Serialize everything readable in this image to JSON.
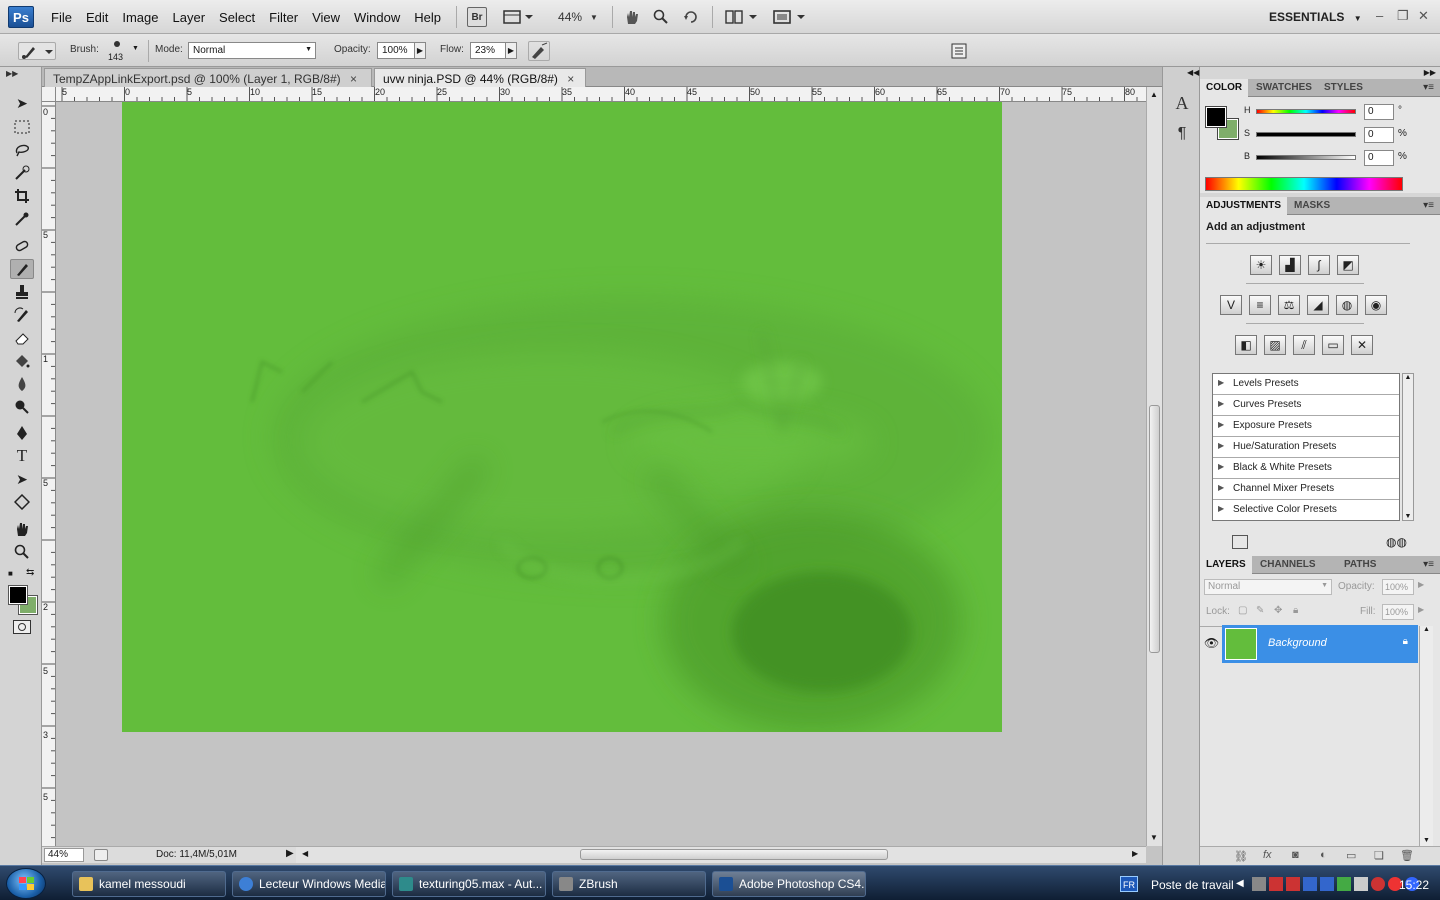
{
  "app": {
    "logo": "Ps",
    "menu": [
      "File",
      "Edit",
      "Image",
      "Layer",
      "Select",
      "Filter",
      "View",
      "Window",
      "Help"
    ],
    "bridge_label": "Br",
    "zoom": "44%",
    "workspace": "ESSENTIALS"
  },
  "options_bar": {
    "brush_label": "Brush:",
    "brush_size": "143",
    "mode_label": "Mode:",
    "mode_value": "Normal",
    "opacity_label": "Opacity:",
    "opacity_value": "100%",
    "flow_label": "Flow:",
    "flow_value": "23%"
  },
  "tabs": [
    {
      "title": "TempZAppLinkExport.psd @ 100% (Layer 1, RGB/8#)",
      "close": "×"
    },
    {
      "title": "uvw ninja.PSD @ 44% (RGB/8#)",
      "close": "×"
    }
  ],
  "ruler": {
    "h_labels": [
      "5",
      "0",
      "5",
      "10",
      "15",
      "20",
      "25",
      "30",
      "35",
      "40",
      "45",
      "50",
      "55",
      "60",
      "65",
      "70",
      "75",
      "80"
    ],
    "v_labels": [
      "0",
      "5",
      "1",
      "5",
      "2",
      "5",
      "3",
      "5"
    ]
  },
  "status": {
    "zoom": "44%",
    "doc": "Doc: 11,4M/5,01M"
  },
  "color_panel": {
    "tabs": [
      "COLOR",
      "SWATCHES",
      "STYLES"
    ],
    "sliders": [
      {
        "label": "H",
        "value": "0",
        "unit": "°"
      },
      {
        "label": "S",
        "value": "0",
        "unit": "%"
      },
      {
        "label": "B",
        "value": "0",
        "unit": "%"
      }
    ]
  },
  "adjustments_panel": {
    "tabs": [
      "ADJUSTMENTS",
      "MASKS"
    ],
    "heading": "Add an adjustment",
    "presets": [
      "Levels Presets",
      "Curves Presets",
      "Exposure Presets",
      "Hue/Saturation Presets",
      "Black & White Presets",
      "Channel Mixer Presets",
      "Selective Color Presets"
    ]
  },
  "layers_panel": {
    "tabs": [
      "LAYERS",
      "CHANNELS",
      "PATHS"
    ],
    "blend_mode": "Normal",
    "opacity_label": "Opacity:",
    "opacity_value": "100%",
    "lock_label": "Lock:",
    "fill_label": "Fill:",
    "fill_value": "100%",
    "layers": [
      {
        "name": "Background"
      }
    ]
  },
  "taskbar": {
    "items": [
      {
        "label": "kamel messoudi"
      },
      {
        "label": "Lecteur Windows Media"
      },
      {
        "label": "texturing05.max - Aut..."
      },
      {
        "label": "ZBrush"
      },
      {
        "label": "Adobe Photoshop CS4..."
      }
    ],
    "lang": "FR",
    "desktop_label": "Poste de travail",
    "time": "15:22"
  },
  "colors": {
    "canvas_green": "#63bd3c",
    "layer_selected": "#3b8fe6",
    "foreground": "#000000",
    "background": "#7fae6a"
  }
}
